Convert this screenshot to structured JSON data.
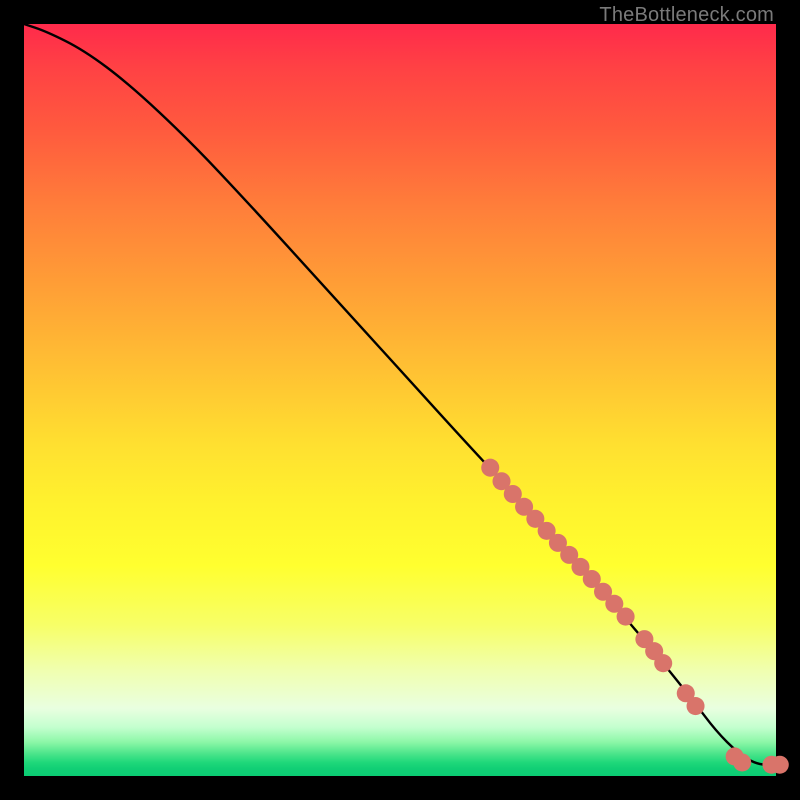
{
  "watermark": "TheBottleneck.com",
  "chart_data": {
    "type": "line",
    "title": "",
    "xlabel": "",
    "ylabel": "",
    "xlim": [
      0,
      100
    ],
    "ylim": [
      0,
      100
    ],
    "grid": false,
    "legend": false,
    "series": [
      {
        "name": "curve",
        "color": "#000000",
        "x": [
          0,
          3,
          8,
          14,
          22,
          30,
          40,
          50,
          60,
          68,
          74,
          80,
          85,
          89,
          92,
          95,
          97.5,
          100
        ],
        "y": [
          100,
          99,
          96.5,
          92,
          84.5,
          76,
          65,
          54,
          43,
          34.5,
          28,
          21,
          15,
          10,
          6,
          3,
          1.5,
          1.5
        ]
      }
    ],
    "markers": [
      {
        "name": "cluster-points",
        "color": "#d9746a",
        "radius_fraction": 0.012,
        "points": [
          {
            "x": 62,
            "y": 41
          },
          {
            "x": 63.5,
            "y": 39.2
          },
          {
            "x": 65,
            "y": 37.5
          },
          {
            "x": 66.5,
            "y": 35.8
          },
          {
            "x": 68,
            "y": 34.2
          },
          {
            "x": 69.5,
            "y": 32.6
          },
          {
            "x": 71,
            "y": 31
          },
          {
            "x": 72.5,
            "y": 29.4
          },
          {
            "x": 74,
            "y": 27.8
          },
          {
            "x": 75.5,
            "y": 26.2
          },
          {
            "x": 77,
            "y": 24.5
          },
          {
            "x": 78.5,
            "y": 22.9
          },
          {
            "x": 80,
            "y": 21.2
          },
          {
            "x": 82.5,
            "y": 18.2
          },
          {
            "x": 83.8,
            "y": 16.6
          },
          {
            "x": 85,
            "y": 15
          },
          {
            "x": 88,
            "y": 11
          },
          {
            "x": 89.3,
            "y": 9.3
          },
          {
            "x": 94.5,
            "y": 2.6
          },
          {
            "x": 95.5,
            "y": 1.8
          },
          {
            "x": 99.4,
            "y": 1.5
          },
          {
            "x": 100.5,
            "y": 1.5
          }
        ]
      }
    ]
  }
}
